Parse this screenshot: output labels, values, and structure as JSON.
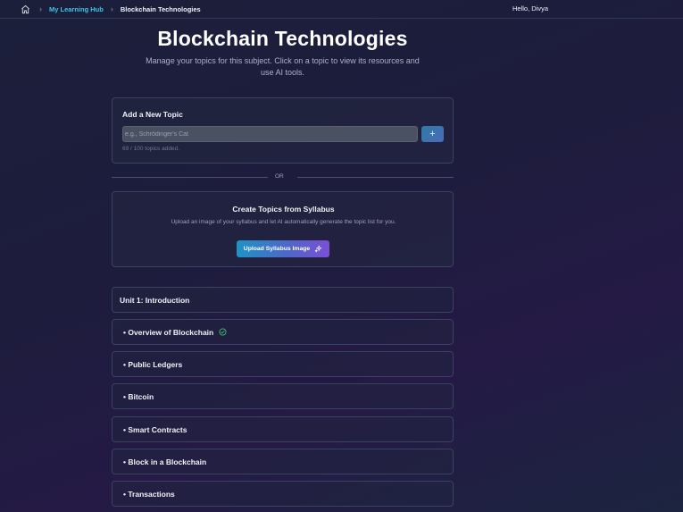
{
  "header": {
    "breadcrumb": [
      {
        "label": "My Learning Hub"
      },
      {
        "label": "Blockchain Technologies"
      }
    ],
    "greeting": "Hello, Divya",
    "icons": {
      "home": "home-icon",
      "separator": "chevron-right-icon"
    }
  },
  "page": {
    "title": "Blockchain Technologies",
    "subtitle": "Manage your topics for this subject. Click on a topic to view its resources and use AI tools."
  },
  "add_topic": {
    "title": "Add a New Topic",
    "input_placeholder": "e.g., Schrödinger's Cat",
    "input_value": "",
    "add_button_label": "+",
    "count_text": "69 / 100 topics added."
  },
  "divider": {
    "label": "OR"
  },
  "syllabus": {
    "title": "Create Topics from Syllabus",
    "description": "Upload an image of your syllabus and let AI automatically generate the topic list for you.",
    "button_label": "Upload Syllabus Image",
    "button_icon": "sparkles-icon"
  },
  "topics": [
    {
      "label": "Unit 1: Introduction",
      "type": "unit",
      "completed": false
    },
    {
      "label": "• Overview of Blockchain",
      "type": "item",
      "completed": true
    },
    {
      "label": "• Public Ledgers",
      "type": "item",
      "completed": false
    },
    {
      "label": "• Bitcoin",
      "type": "item",
      "completed": false
    },
    {
      "label": "• Smart Contracts",
      "type": "item",
      "completed": false
    },
    {
      "label": "• Block in a Blockchain",
      "type": "item",
      "completed": false
    },
    {
      "label": "• Transactions",
      "type": "item",
      "completed": false
    }
  ],
  "colors": {
    "accent_cyan": "#3ec3e8",
    "check_green": "#3fbf6f",
    "button_gradient_start": "#1e93c4",
    "button_gradient_end": "#7a4fd6"
  }
}
